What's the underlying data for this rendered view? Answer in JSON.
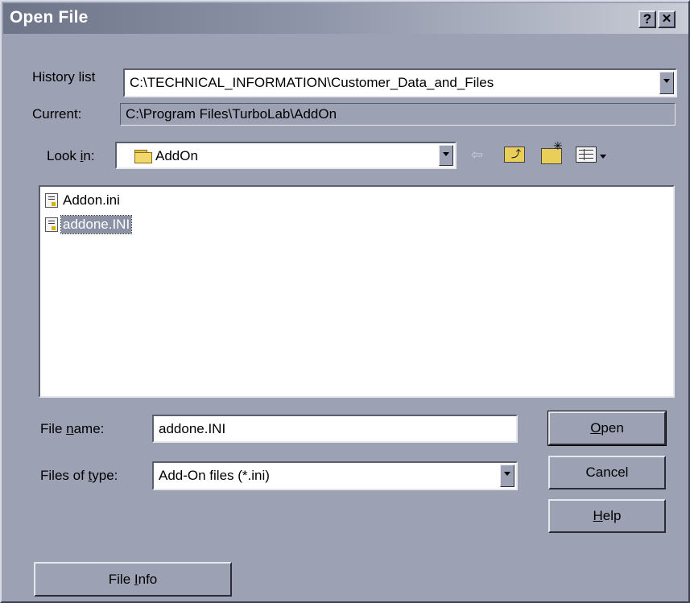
{
  "window": {
    "title": "Open File",
    "help_button": "?",
    "close_button": "✕"
  },
  "history": {
    "label": "History list",
    "value": "C:\\TECHNICAL_INFORMATION\\Customer_Data_and_Files"
  },
  "current": {
    "label": "Current:",
    "value": "C:\\Program Files\\TurboLab\\AddOn"
  },
  "look_in": {
    "label_pre": "Look ",
    "label_ul": "i",
    "label_post": "n:",
    "value": "AddOn"
  },
  "toolbar": {
    "back_icon": "back-arrow-icon",
    "up_icon": "up-folder-icon",
    "new_folder_icon": "new-folder-icon",
    "view_icon": "view-menu-icon"
  },
  "files": [
    {
      "name": "Addon.ini",
      "selected": false
    },
    {
      "name": "addone.INI",
      "selected": true
    }
  ],
  "file_name": {
    "label_pre": "File ",
    "label_ul": "n",
    "label_post": "ame:",
    "value": "addone.INI"
  },
  "file_type": {
    "label_pre": "Files of ",
    "label_ul": "t",
    "label_post": "ype:",
    "value": "Add-On files (*.ini)"
  },
  "buttons": {
    "open_ul": "O",
    "open_rest": "pen",
    "cancel": "Cancel",
    "help_ul": "H",
    "help_rest": "elp",
    "file_info_pre": "File ",
    "file_info_ul": "I",
    "file_info_post": "nfo"
  }
}
